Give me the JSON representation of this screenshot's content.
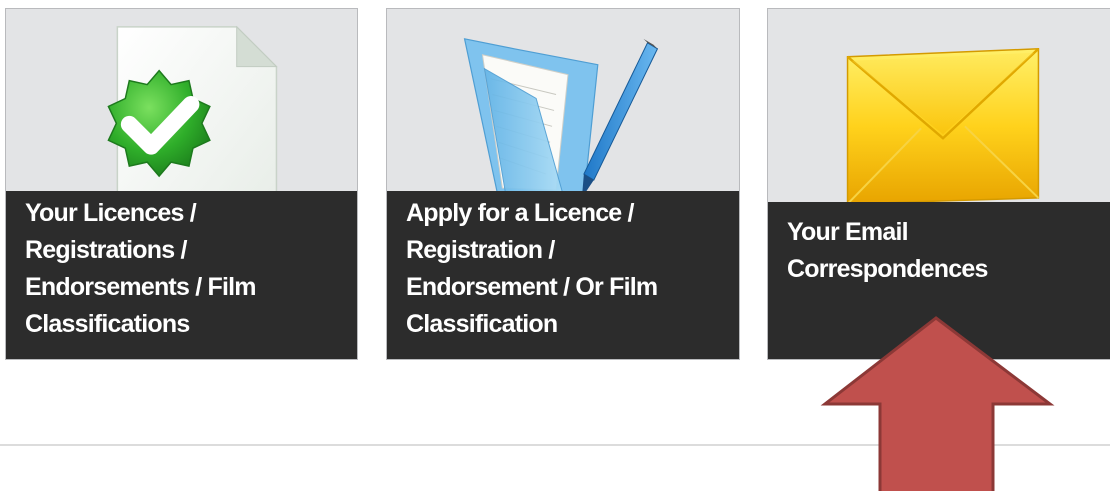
{
  "tiles": [
    {
      "lines": [
        "Your Licences /",
        "Registrations /",
        "Endorsements / Film",
        "Classifications"
      ],
      "icon": "licence-approved-icon"
    },
    {
      "lines": [
        "Apply for a Licence /",
        "Registration /",
        "Endorsement / Or Film",
        "Classification"
      ],
      "icon": "folder-pen-icon"
    },
    {
      "lines": [
        "Your Email",
        "Correspondences"
      ],
      "icon": "email-envelope-icon"
    }
  ],
  "colors": {
    "tile_background": "#e3e4e6",
    "caption_background": "#2c2c2c",
    "caption_text": "#ffffff",
    "arrow_fill": "#c0504d",
    "arrow_stroke": "#8c3836"
  },
  "annotation": {
    "icon": "up-arrow-annotation",
    "points_to": "Your Email Correspondences"
  }
}
